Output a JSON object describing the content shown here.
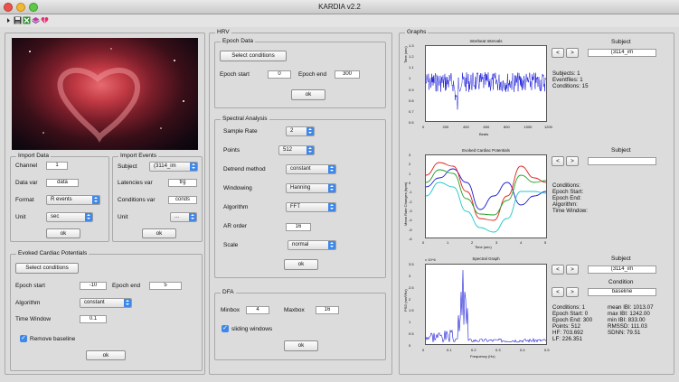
{
  "window": {
    "title": "KARDIA v2.2"
  },
  "toolbar": {
    "icons": [
      "arrow-icon",
      "save-icon",
      "excel-icon",
      "layers-icon",
      "broken-heart-icon"
    ]
  },
  "import_data": {
    "title": "Import Data",
    "channel_label": "Channel",
    "channel_value": "1",
    "datavar_label": "Data var",
    "datavar_value": "data",
    "format_label": "Format",
    "format_value": "R events",
    "unit_label": "Unit",
    "unit_value": "sec",
    "ok": "ok"
  },
  "import_events": {
    "title": "Import Events",
    "subject_label": "Subject",
    "subject_value": "(3114_im",
    "latencies_label": "Latencies var",
    "latencies_value": "trg",
    "conditions_label": "Conditions var",
    "conditions_value": "conds",
    "unit_label": "Unit",
    "unit_value": "...",
    "ok": "ok"
  },
  "ecp": {
    "title": "Evoked Cardiac Potentials",
    "select_btn": "Select conditions",
    "epoch_start_label": "Epoch start",
    "epoch_start_value": "-10",
    "epoch_end_label": "Epoch end",
    "epoch_end_value": "5",
    "algorithm_label": "Algorithm",
    "algorithm_value": "constant",
    "timewindow_label": "Time Window",
    "timewindow_value": "0.1",
    "remove_baseline": "Remove baseline",
    "ok": "ok"
  },
  "hrv": {
    "title": "HRV",
    "epoch": {
      "title": "Epoch Data",
      "select_btn": "Select conditions",
      "start_label": "Epoch start",
      "start_value": "0",
      "end_label": "Epoch end",
      "end_value": "300",
      "ok": "ok"
    },
    "spectral": {
      "title": "Spectral Analysis",
      "sample_rate_label": "Sample Rate",
      "sample_rate_value": "2",
      "points_label": "Points",
      "points_value": "512",
      "detrend_label": "Detrend method",
      "detrend_value": "constant",
      "windowing_label": "Windowing",
      "windowing_value": "Hanning",
      "algorithm_label": "Algorithm",
      "algorithm_value": "FFT",
      "ar_label": "AR order",
      "ar_value": "16",
      "scale_label": "Scale",
      "scale_value": "normal",
      "ok": "ok"
    },
    "dfa": {
      "title": "DFA",
      "minbox_label": "Minbox",
      "minbox_value": "4",
      "maxbox_label": "Maxbox",
      "maxbox_value": "16",
      "sliding": "sliding windows",
      "ok": "ok"
    }
  },
  "graphs": {
    "title": "Graphs",
    "ibi": {
      "plot_title": "Interbeat Intervals",
      "ylabel": "Time (sec)",
      "xlabel": "Beats",
      "yticks": [
        "1.3",
        "1.2",
        "1.1",
        "1",
        "0.9",
        "0.8",
        "0.7",
        "0.6"
      ],
      "xticks": [
        "0",
        "200",
        "400",
        "600",
        "800",
        "1000",
        "1200"
      ],
      "subject_label": "Subject",
      "subject_value": "(3114_im",
      "prev": "<",
      "next": ">",
      "info": "Subjects: 1\nEventfiles: 1\nConditions: 15"
    },
    "ecp": {
      "plot_title": "Evoked Cardiac Potentials",
      "ylabel": "Mean Rate Changes (bpm)",
      "xlabel": "Time (sec)",
      "yticks": [
        "3",
        "2",
        "1",
        "0",
        "-1",
        "-2",
        "-3",
        "-4",
        "-5",
        "-6"
      ],
      "xticks": [
        "0",
        "1",
        "2",
        "3",
        "4",
        "5"
      ],
      "subject_label": "Subject",
      "subject_value": "",
      "prev": "<",
      "next": ">",
      "info": "Conditions:\nEpoch Start:\nEpoch End:\nAlgorithm:\nTime Window:",
      "colors": [
        "#1f1fd0",
        "#e02020",
        "#20a020",
        "#20c8c8"
      ]
    },
    "spectral": {
      "plot_title": "Spectral Graph",
      "ylabel": "PSD (ms²/Hz)",
      "xlabel": "Frequency (Hz)",
      "exponent": "x 10^6",
      "yticks": [
        "3.5",
        "3",
        "2.5",
        "2",
        "1.5",
        "1",
        "0.5",
        "0"
      ],
      "xticks": [
        "0",
        "0.1",
        "0.2",
        "0.3",
        "0.4",
        "0.5"
      ],
      "subject_label": "Subject",
      "subject_value": "(3114_im",
      "condition_label": "Condition",
      "condition_value": "baseline",
      "prev": "<",
      "next": ">",
      "info_left": "Conditions: 1\nEpoch Start: 0\nEpoch End: 300\nPoints: 512\nHF: 703.692\nLF: 226.351",
      "info_right": "mean IBI: 1013.07\nmax IBI: 1242.00\nmin IBI: 833.00\nRMSSD: 111.03\nSDNN: 79.51"
    }
  }
}
